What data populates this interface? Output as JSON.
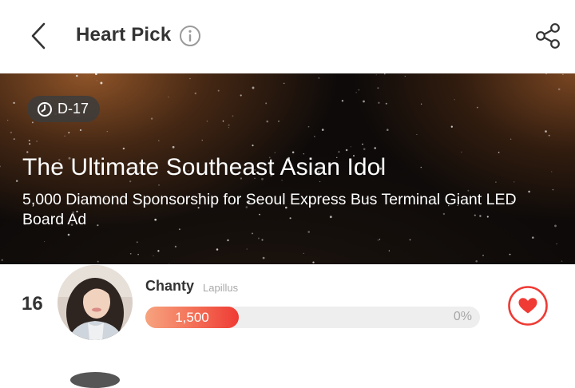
{
  "header": {
    "title": "Heart Pick"
  },
  "banner": {
    "dday": "D-17",
    "title": "The Ultimate Southeast Asian Idol",
    "subtitle": "5,000 Diamond Sponsorship for Seoul Express Bus Terminal Giant LED Board Ad"
  },
  "entry": {
    "rank": "16",
    "name": "Chanty",
    "group": "Lapillus",
    "votes": "1,500",
    "percent": "0%",
    "progress": 0.28
  },
  "colors": {
    "accent": "#ef3b34",
    "bar_track": "#eeeeee",
    "muted_text": "#a8a8a8"
  },
  "icons": {
    "back": "chevron-left-icon",
    "info": "info-icon",
    "share": "share-icon",
    "clock": "clock-icon",
    "heart": "heart-icon"
  }
}
